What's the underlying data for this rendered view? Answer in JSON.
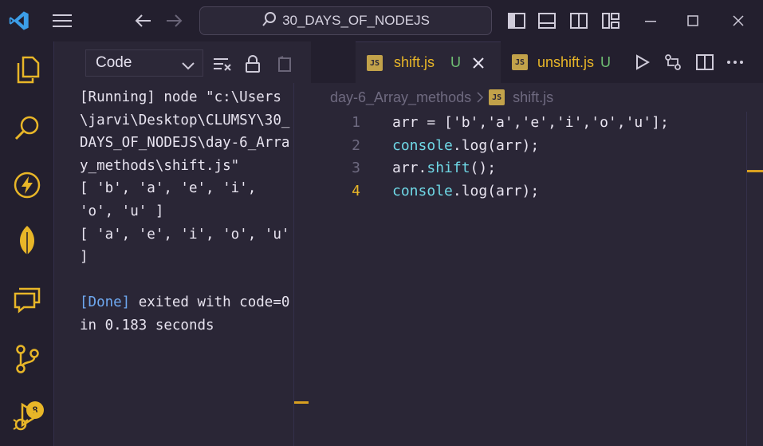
{
  "window": {
    "search_title": "30_DAYS_OF_NODEJS"
  },
  "activitybar": {
    "source_control_badge": "8"
  },
  "output": {
    "channel_selected": "Code",
    "lines": [
      {
        "prefix": "",
        "text": "[Running] node \"c:\\Users\\jarvi\\Desktop\\CLUMSY\\30_DAYS_OF_NODEJS\\day-6_Array_methods\\shift.js\""
      },
      {
        "prefix": "",
        "text": "[ 'b', 'a', 'e', 'i', 'o', 'u' ]"
      },
      {
        "prefix": "",
        "text": "[ 'a', 'e', 'i', 'o', 'u' ]"
      },
      {
        "prefix": "",
        "text": ""
      },
      {
        "prefix": "[Done]",
        "text": " exited with code=0 in 0.183 seconds"
      }
    ],
    "partial_tab_status": "U"
  },
  "editor": {
    "tabs": [
      {
        "icon": "JS",
        "name": "shift.js",
        "status": "U",
        "active": true
      },
      {
        "icon": "JS",
        "name": "unshift.js",
        "status": "U",
        "active": false
      }
    ],
    "breadcrumb": {
      "folder": "day-6_Array_methods",
      "icon": "JS",
      "file": "shift.js"
    },
    "lines": [
      {
        "num": "1",
        "parts": [
          [
            "arr = ['b','a','e','i','o','u'];",
            "#e8e4f0"
          ]
        ]
      },
      {
        "num": "2",
        "parts": [
          [
            "console",
            "#6fd8e6"
          ],
          [
            ".log(arr);",
            "#e8e4f0"
          ]
        ]
      },
      {
        "num": "3",
        "parts": [
          [
            "arr",
            "#e8e4f0"
          ],
          [
            ".",
            "#e8e4f0"
          ],
          [
            "shift",
            "#6fd8e6"
          ],
          [
            "();",
            "#e8e4f0"
          ]
        ]
      },
      {
        "num": "4",
        "parts": [
          [
            "console",
            "#6fd8e6"
          ],
          [
            ".log(arr);",
            "#e8e4f0"
          ]
        ]
      }
    ],
    "current_line": "4"
  },
  "colors": {
    "accent_yellow": "#e8b628",
    "untracked_green": "#6fbf73",
    "keyword_cyan": "#6fd8e6",
    "done_blue": "#6ea8f0"
  }
}
